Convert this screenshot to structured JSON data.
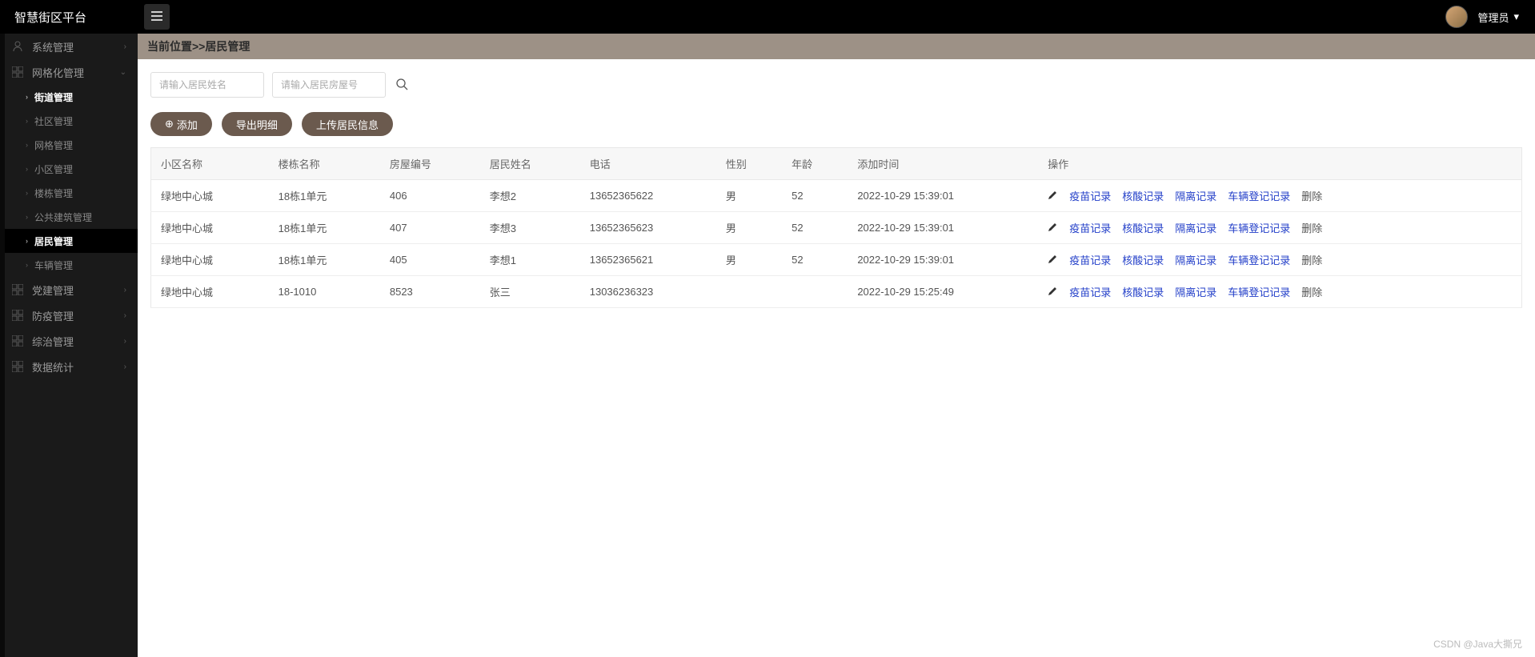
{
  "app": {
    "title": "智慧街区平台",
    "user_role": "管理员"
  },
  "sidebar": {
    "menus": [
      {
        "label": "系统管理",
        "expandable": true
      },
      {
        "label": "网格化管理",
        "expandable": true,
        "open": true,
        "children": [
          {
            "label": "街道管理",
            "bold": true
          },
          {
            "label": "社区管理"
          },
          {
            "label": "网格管理"
          },
          {
            "label": "小区管理"
          },
          {
            "label": "楼栋管理"
          },
          {
            "label": "公共建筑管理"
          },
          {
            "label": "居民管理",
            "active": true
          },
          {
            "label": "车辆管理"
          }
        ]
      },
      {
        "label": "党建管理",
        "expandable": true
      },
      {
        "label": "防疫管理",
        "expandable": true
      },
      {
        "label": "综治管理",
        "expandable": true
      },
      {
        "label": "数据统计",
        "expandable": true
      }
    ]
  },
  "breadcrumb": {
    "prefix": "当前位置>>",
    "current": "居民管理"
  },
  "search": {
    "name_placeholder": "请输入居民姓名",
    "room_placeholder": "请输入居民房屋号"
  },
  "actions": {
    "add": "添加",
    "export": "导出明细",
    "upload": "上传居民信息"
  },
  "table": {
    "headers": [
      "小区名称",
      "楼栋名称",
      "房屋编号",
      "居民姓名",
      "电话",
      "性别",
      "年龄",
      "添加时间",
      "操作"
    ],
    "rows": [
      {
        "community": "绿地中心城",
        "building": "18栋1单元",
        "room": "406",
        "name": "李想2",
        "phone": "13652365622",
        "gender": "男",
        "age": "52",
        "time": "2022-10-29 15:39:01"
      },
      {
        "community": "绿地中心城",
        "building": "18栋1单元",
        "room": "407",
        "name": "李想3",
        "phone": "13652365623",
        "gender": "男",
        "age": "52",
        "time": "2022-10-29 15:39:01"
      },
      {
        "community": "绿地中心城",
        "building": "18栋1单元",
        "room": "405",
        "name": "李想1",
        "phone": "13652365621",
        "gender": "男",
        "age": "52",
        "time": "2022-10-29 15:39:01"
      },
      {
        "community": "绿地中心城",
        "building": "18-1010",
        "room": "8523",
        "name": "张三",
        "phone": "13036236323",
        "gender": "",
        "age": "",
        "time": "2022-10-29 15:25:49"
      }
    ],
    "ops": {
      "vaccine": "疫苗记录",
      "nucleic": "核酸记录",
      "isolate": "隔离记录",
      "vehicle": "车辆登记记录",
      "delete": "删除"
    }
  },
  "watermark": "CSDN @Java大撕兄"
}
